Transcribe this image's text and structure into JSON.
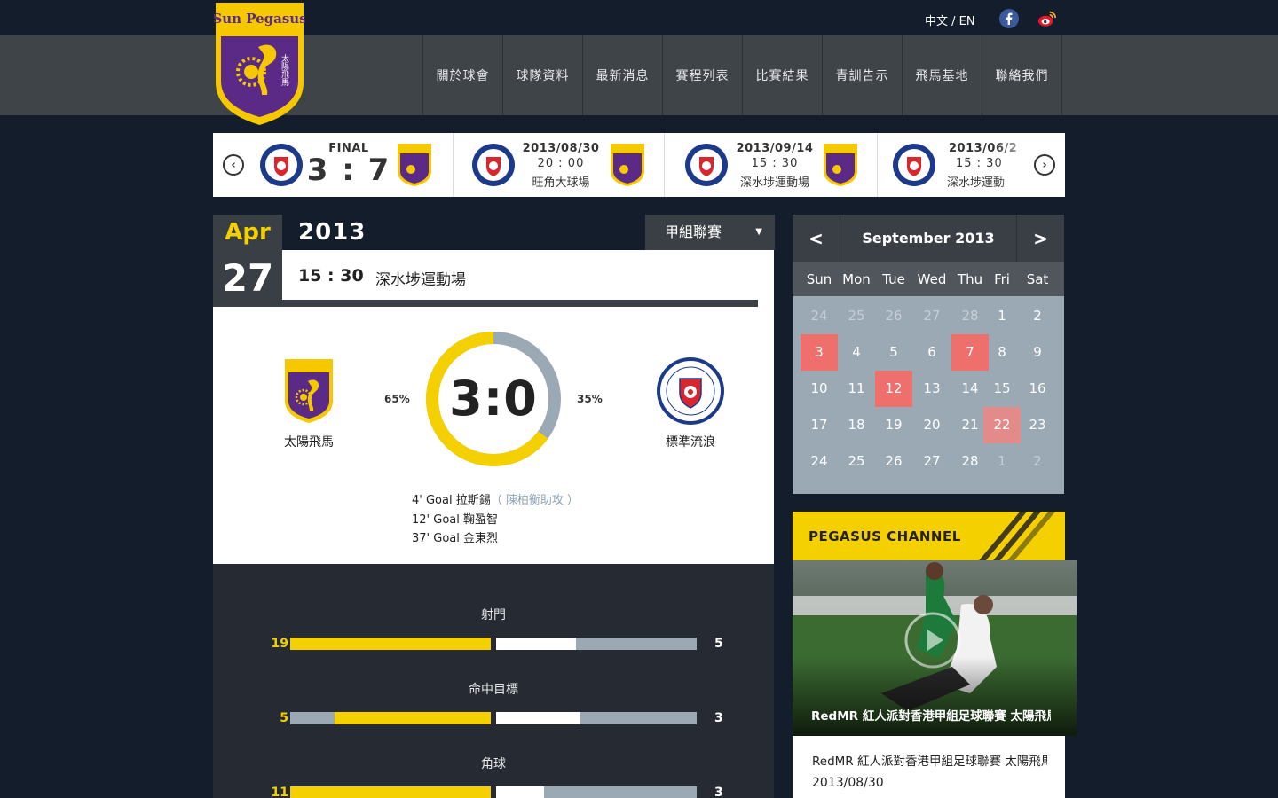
{
  "header": {
    "logo_text": "Sun Pegasus",
    "logo_subtext": "太陽飛馬",
    "lang_zh": "中文",
    "lang_sep": " / ",
    "lang_en": "EN",
    "nav": [
      "關於球會",
      "球隊資料",
      "最新消息",
      "賽程列表",
      "比賽結果",
      "青訓告示",
      "飛馬基地",
      "聯絡我們"
    ]
  },
  "fixtures": [
    {
      "status": "FINAL",
      "score": "3 : 7"
    },
    {
      "date": "2013/08/30",
      "time": "20 : 00",
      "venue": "旺角大球場"
    },
    {
      "date": "2013/09/14",
      "time": "15 : 30",
      "venue": "深水埗運動場"
    },
    {
      "date": "2013/06/2",
      "time": "15 : 30",
      "venue": "深水埗運動"
    }
  ],
  "match": {
    "month": "Apr",
    "year": "2013",
    "league": "甲組聯賽",
    "league_caret": "▼",
    "day": "27",
    "time": "15 : 30",
    "venue": "深水埗運動場",
    "home_team": "太陽飛馬",
    "away_team": "標準流浪",
    "home_pct": "65%",
    "away_pct": "35%",
    "possession_home": 0.65,
    "score": "3:0",
    "events": [
      {
        "text": "4' Goal 拉斯錫",
        "assist": "（ 陳柏衡助攻 ）"
      },
      {
        "text": "12' Goal 鞠盈智",
        "assist": ""
      },
      {
        "text": "37' Goal 金東烈",
        "assist": ""
      }
    ]
  },
  "stats": [
    {
      "label": "射門",
      "home": "19",
      "away": "5",
      "home_fill": 1.0,
      "away_fill": 0.4
    },
    {
      "label": "命中目標",
      "home": "5",
      "away": "3",
      "home_fill": 0.78,
      "away_fill": 0.42
    },
    {
      "label": "角球",
      "home": "11",
      "away": "3",
      "home_fill": 1.0,
      "away_fill": 0.24
    }
  ],
  "calendar": {
    "prev": "<",
    "next": ">",
    "title": "September 2013",
    "dow": [
      "Sun",
      "Mon",
      "Tue",
      "Wed",
      "Thu",
      "Fri",
      "Sat"
    ],
    "weeks": [
      [
        "24",
        "25",
        "26",
        "27",
        "28",
        "1",
        "2"
      ],
      [
        "3",
        "4",
        "5",
        "6",
        "7",
        "8",
        "9"
      ],
      [
        "10",
        "11",
        "12",
        "13",
        "14",
        "15",
        "16"
      ],
      [
        "17",
        "18",
        "19",
        "20",
        "21",
        "22",
        "23"
      ],
      [
        "24",
        "25",
        "26",
        "27",
        "28",
        "1",
        "2"
      ]
    ],
    "highlight_color": "#ef6f6c"
  },
  "channel": {
    "title": "PEGASUS CHANNEL",
    "caption": "RedMR 紅人派對香港甲組足球聯賽 太陽飛馬",
    "item_title": "RedMR 紅人派對香港甲組足球聯賽 太陽飛馬",
    "item_date": "2013/08/30"
  },
  "colors": {
    "accent": "#f5d000",
    "dark": "#141d2b",
    "grey_bar": "#9aa9b4",
    "purple": "#5b2a86"
  }
}
